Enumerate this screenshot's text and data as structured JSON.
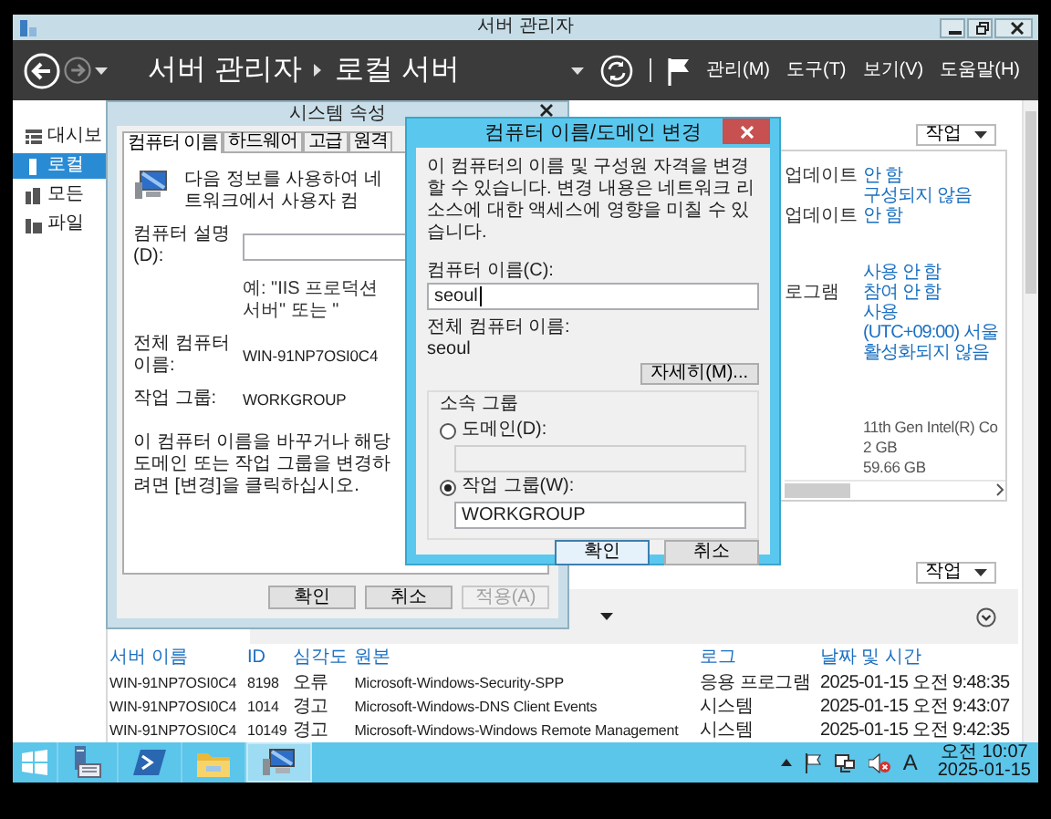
{
  "window": {
    "title": "서버 관리자"
  },
  "header": {
    "navigation": [
      {
        "kind": "back",
        "disabled": false
      },
      {
        "kind": "forward",
        "disabled": true
      }
    ],
    "breadcrumb": [
      "서버 관리자",
      "로컬 서버"
    ],
    "menus": [
      "관리(M)",
      "도구(T)",
      "보기(V)",
      "도움말(H)"
    ]
  },
  "sidebar": {
    "items": [
      {
        "kind": "dashboard",
        "label": "대시보",
        "selected": false
      },
      {
        "kind": "local-server",
        "label": "로컬",
        "selected": true
      },
      {
        "kind": "all-servers",
        "label": "모든",
        "selected": false
      },
      {
        "kind": "file-services",
        "label": "파일",
        "selected": false
      }
    ]
  },
  "properties": {
    "tasks_button": "작업",
    "groups": [
      {
        "rows": [
          {
            "label": "업데이트",
            "value": "안 함",
            "link": true
          },
          {
            "value": "구성되지 않음",
            "link": true
          },
          {
            "label": "업데이트",
            "value": "안 함",
            "link": true
          }
        ]
      },
      {
        "rows": [
          {
            "value": "사용 안 함",
            "link": true
          },
          {
            "label": "로그램",
            "value": "참여 안 함",
            "link": true
          },
          {
            "value": "사용",
            "link": true
          },
          {
            "value": "(UTC+09:00) 서울",
            "link": true
          },
          {
            "value": "활성화되지 않음",
            "link": true
          }
        ]
      },
      {
        "rows": [
          {
            "value": "11th Gen Intel(R) Co",
            "link": false
          },
          {
            "value": "2 GB",
            "link": false
          },
          {
            "value": "59.66 GB",
            "link": false
          }
        ]
      }
    ]
  },
  "events": {
    "tasks_button": "작업",
    "columns": [
      "서버 이름",
      "ID",
      "심각도",
      "원본",
      "로그",
      "날짜 및 시간"
    ],
    "rows": [
      [
        "WIN-91NP7OSI0C4",
        "8198",
        "오류",
        "Microsoft-Windows-Security-SPP",
        "응용 프로그램",
        "2025-01-15 오전 9:48:35"
      ],
      [
        "WIN-91NP7OSI0C4",
        "1014",
        "경고",
        "Microsoft-Windows-DNS Client Events",
        "시스템",
        "2025-01-15 오전 9:43:07"
      ],
      [
        "WIN-91NP7OSI0C4",
        "10149",
        "경고",
        "Microsoft-Windows-Windows Remote Management",
        "시스템",
        "2025-01-15 오전 9:42:35"
      ]
    ]
  },
  "system_properties": {
    "title": "시스템 속성",
    "tabs": [
      {
        "label": "컴퓨터 이름",
        "selected": true
      },
      {
        "label": "하드웨어",
        "selected": false
      },
      {
        "label": "고급",
        "selected": false
      },
      {
        "label": "원격",
        "selected": false
      }
    ],
    "intro": "다음 정보를 사용하여 네트워크에서 사용자 컴",
    "description_label": "컴퓨터 설명(D):",
    "description_hint": "예: \"IIS 프로덕션 서버\" 또는 \"",
    "full_name_label": "전체 컴퓨터 이름:",
    "full_name": "WIN-91NP7OSI0C4",
    "workgroup_label": "작업 그룹:",
    "workgroup": "WORKGROUP",
    "change_note": "이 컴퓨터 이름을 바꾸거나 해당 도메인 또는 작업 그룹을 변경하려면 [변경]을 클릭하십시오.",
    "buttons": [
      {
        "label": "확인",
        "disabled": false
      },
      {
        "label": "취소",
        "disabled": false
      },
      {
        "label": "적용(A)",
        "disabled": true
      }
    ]
  },
  "rename_dialog": {
    "title": "컴퓨터 이름/도메인 변경",
    "description": "이 컴퓨터의 이름 및 구성원 자격을 변경할 수 있습니다. 변경 내용은 네트워크 리소스에 대한 액세스에 영향을 미칠 수 있습니다.",
    "name_label": "컴퓨터 이름(C):",
    "name_value": "seoul",
    "full_name_label": "전체 컴퓨터 이름:",
    "full_name": "seoul",
    "more_button": "자세히(M)...",
    "member_of": {
      "title": "소속 그룹",
      "options": [
        {
          "label": "도메인(D):",
          "selected": false,
          "field_disabled": true
        },
        {
          "label": "작업 그룹(W):",
          "selected": true,
          "field_disabled": false,
          "value": "WORKGROUP"
        }
      ]
    },
    "buttons": [
      {
        "label": "확인",
        "default": true
      },
      {
        "label": "취소",
        "default": false
      }
    ]
  },
  "taskbar": {
    "apps": [
      {
        "kind": "start",
        "selected": false
      },
      {
        "kind": "server-manager",
        "selected": false
      },
      {
        "kind": "powershell",
        "selected": false
      },
      {
        "kind": "explorer",
        "selected": false
      },
      {
        "kind": "system",
        "selected": true
      }
    ],
    "tray": [
      {
        "kind": "arrow"
      },
      {
        "kind": "flag"
      },
      {
        "kind": "network"
      },
      {
        "kind": "volume-muted"
      }
    ],
    "input_indicator": "A",
    "time": "오전 10:07",
    "date": "2025-01-15"
  }
}
